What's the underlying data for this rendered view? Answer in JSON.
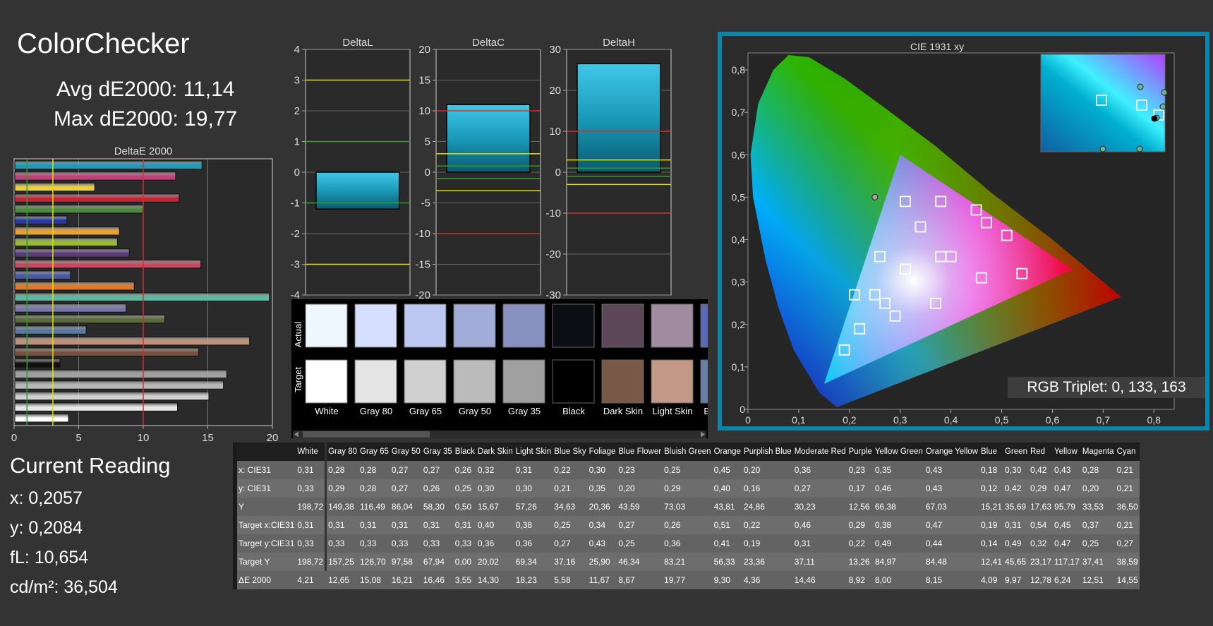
{
  "title": "ColorChecker",
  "avg_label": "Avg dE2000: 11,14",
  "max_label": "Max dE2000: 19,77",
  "current": {
    "title": "Current Reading",
    "x": "x: 0,2057",
    "y": "y: 0,2084",
    "fl": "fL: 10,654",
    "cd": "cd/m²: 36,504"
  },
  "rgb_triplet": "RGB Triplet: 0, 133, 163",
  "colors": {
    "accent_frame": "#0a86ad",
    "bar_fill": "#1a9ab8"
  },
  "deltae_chart": {
    "title": "DeltaE 2000",
    "ticks": [
      "0",
      "5",
      "10",
      "15",
      "20"
    ],
    "xlim": [
      0,
      20
    ],
    "ref_lines": [
      {
        "value": 1,
        "color": "#2aa02a"
      },
      {
        "value": 3,
        "color": "#e0e000"
      },
      {
        "value": 10,
        "color": "#d03030"
      }
    ],
    "bars": [
      {
        "value": 14.55,
        "color": "#1a9ab8"
      },
      {
        "value": 12.51,
        "color": "#c0407a"
      },
      {
        "value": 6.24,
        "color": "#e8d040"
      },
      {
        "value": 12.78,
        "color": "#c02838"
      },
      {
        "value": 9.97,
        "color": "#4a8a3a"
      },
      {
        "value": 4.09,
        "color": "#2838a0"
      },
      {
        "value": 8.15,
        "color": "#e8a030"
      },
      {
        "value": 8.0,
        "color": "#98b838"
      },
      {
        "value": 8.92,
        "color": "#5a3a78"
      },
      {
        "value": 14.46,
        "color": "#c84860"
      },
      {
        "value": 4.36,
        "color": "#4858a8"
      },
      {
        "value": 9.3,
        "color": "#e07828"
      },
      {
        "value": 19.77,
        "color": "#5ab8a0"
      },
      {
        "value": 8.67,
        "color": "#7878b0"
      },
      {
        "value": 11.67,
        "color": "#5a6a38"
      },
      {
        "value": 5.58,
        "color": "#5878a0"
      },
      {
        "value": 18.23,
        "color": "#c09078"
      },
      {
        "value": 14.3,
        "color": "#785040"
      },
      {
        "value": 3.55,
        "color": "#101010"
      },
      {
        "value": 16.46,
        "color": "#a0a0a0"
      },
      {
        "value": 16.21,
        "color": "#b8b8b8"
      },
      {
        "value": 15.08,
        "color": "#d0d0d0"
      },
      {
        "value": 12.65,
        "color": "#e6e6e6"
      },
      {
        "value": 4.21,
        "color": "#ffffff"
      }
    ]
  },
  "delta_charts": [
    {
      "title": "DeltaL",
      "ticks": [
        "4",
        "3",
        "2",
        "1",
        "0",
        "-1",
        "-2",
        "-3",
        "-4"
      ],
      "ylim": [
        -4,
        4
      ],
      "bar_value": -1.2,
      "yellow": [
        3,
        -3
      ],
      "green": [
        1,
        -1
      ],
      "red": []
    },
    {
      "title": "DeltaC",
      "ticks": [
        "20",
        "15",
        "10",
        "5",
        "0",
        "-5",
        "-10",
        "-15",
        "-20"
      ],
      "ylim": [
        -20,
        20
      ],
      "bar_value": 11,
      "yellow": [
        3,
        -3
      ],
      "green": [
        1,
        -1
      ],
      "red": [
        10,
        -10
      ]
    },
    {
      "title": "DeltaH",
      "ticks": [
        "30",
        "20",
        "10",
        "0",
        "-10",
        "-20",
        "-30"
      ],
      "ylim": [
        -30,
        30
      ],
      "bar_value": 26.5,
      "yellow": [
        3,
        -3
      ],
      "green": [
        1,
        -1
      ],
      "red": [
        10,
        -10
      ]
    }
  ],
  "swatches": {
    "actual_label": "Actual",
    "target_label": "Target",
    "items": [
      {
        "name": "White",
        "actual": "#eef6ff",
        "target": "#ffffff"
      },
      {
        "name": "Gray 80",
        "actual": "#d6e0fe",
        "target": "#e4e4e4"
      },
      {
        "name": "Gray 65",
        "actual": "#bcc8f2",
        "target": "#d0d0d0"
      },
      {
        "name": "Gray 50",
        "actual": "#a2acd8",
        "target": "#bbbbbb"
      },
      {
        "name": "Gray 35",
        "actual": "#8890c0",
        "target": "#a0a0a0"
      },
      {
        "name": "Black",
        "actual": "#0c0e14",
        "target": "#000000"
      },
      {
        "name": "Dark Skin",
        "actual": "#5c4858",
        "target": "#7a5848"
      },
      {
        "name": "Light Skin",
        "actual": "#a08ca0",
        "target": "#c49888"
      },
      {
        "name": "Blue Sky",
        "actual": "#5a6ab8",
        "target": "#6680a8"
      }
    ]
  },
  "cie": {
    "title": "CIE 1931 xy",
    "xticks": [
      "0",
      "0,1",
      "0,2",
      "0,3",
      "0,4",
      "0,5",
      "0,6",
      "0,7",
      "0,8"
    ],
    "yticks": [
      "0",
      "0,1",
      "0,2",
      "0,3",
      "0,4",
      "0,5",
      "0,6",
      "0,7",
      "0,8"
    ],
    "xlim": [
      0,
      0.84
    ],
    "ylim": [
      0,
      0.84
    ]
  },
  "table": {
    "columns": [
      "",
      "White",
      "Gray 80",
      "Gray 65",
      "Gray 50",
      "Gray 35",
      "Black",
      "Dark Skin",
      "Light Skin",
      "Blue Sky",
      "Foliage",
      "Blue Flower",
      "Bluish Green",
      "Orange",
      "Purplish Blue",
      "Moderate Red",
      "Purple",
      "Yellow Green",
      "Orange Yellow",
      "Blue",
      "Green",
      "Red",
      "Yellow",
      "Magenta",
      "Cyan"
    ],
    "rows": [
      [
        "x: CIE31",
        "0,31",
        "0,28",
        "0,28",
        "0,27",
        "0,27",
        "0,26",
        "0,32",
        "0,31",
        "0,22",
        "0,30",
        "0,23",
        "0,25",
        "0,45",
        "0,20",
        "0,36",
        "0,23",
        "0,35",
        "0,43",
        "0,18",
        "0,30",
        "0,42",
        "0,43",
        "0,28",
        "0,21"
      ],
      [
        "y: CIE31",
        "0,33",
        "0,29",
        "0,28",
        "0,27",
        "0,26",
        "0,25",
        "0,30",
        "0,30",
        "0,21",
        "0,35",
        "0,20",
        "0,29",
        "0,40",
        "0,16",
        "0,27",
        "0,17",
        "0,46",
        "0,43",
        "0,12",
        "0,42",
        "0,29",
        "0,47",
        "0,20",
        "0,21"
      ],
      [
        "Y",
        "198,72",
        "149,38",
        "116,49",
        "86,04",
        "58,30",
        "0,50",
        "15,67",
        "57,26",
        "34,63",
        "20,36",
        "43,59",
        "73,03",
        "43,81",
        "24,86",
        "30,23",
        "12,56",
        "66,38",
        "67,03",
        "15,21",
        "35,69",
        "17,63",
        "95,79",
        "33,53",
        "36,50"
      ],
      [
        "Target x:CIE31",
        "0,31",
        "0,31",
        "0,31",
        "0,31",
        "0,31",
        "0,31",
        "0,40",
        "0,38",
        "0,25",
        "0,34",
        "0,27",
        "0,26",
        "0,51",
        "0,22",
        "0,46",
        "0,29",
        "0,38",
        "0,47",
        "0,19",
        "0,31",
        "0,54",
        "0,45",
        "0,37",
        "0,21"
      ],
      [
        "Target y:CIE31",
        "0,33",
        "0,33",
        "0,33",
        "0,33",
        "0,33",
        "0,33",
        "0,36",
        "0,36",
        "0,27",
        "0,43",
        "0,25",
        "0,36",
        "0,41",
        "0,19",
        "0,31",
        "0,22",
        "0,49",
        "0,44",
        "0,14",
        "0,49",
        "0,32",
        "0,47",
        "0,25",
        "0,27"
      ],
      [
        "Target Y",
        "198,72",
        "157,25",
        "126,70",
        "97,58",
        "67,94",
        "0,00",
        "20,02",
        "69,34",
        "37,16",
        "25,90",
        "46,34",
        "83,21",
        "56,33",
        "23,36",
        "37,11",
        "13,26",
        "84,97",
        "84,48",
        "12,41",
        "45,65",
        "23,17",
        "117,17",
        "37,41",
        "38,59"
      ],
      [
        "ΔE 2000",
        "4,21",
        "12,65",
        "15,08",
        "16,21",
        "16,46",
        "3,55",
        "14,30",
        "18,23",
        "5,58",
        "11,67",
        "8,67",
        "19,77",
        "9,30",
        "4,36",
        "14,46",
        "8,92",
        "8,00",
        "8,15",
        "4,09",
        "9,97",
        "12,78",
        "6,24",
        "12,51",
        "14,55"
      ]
    ]
  }
}
